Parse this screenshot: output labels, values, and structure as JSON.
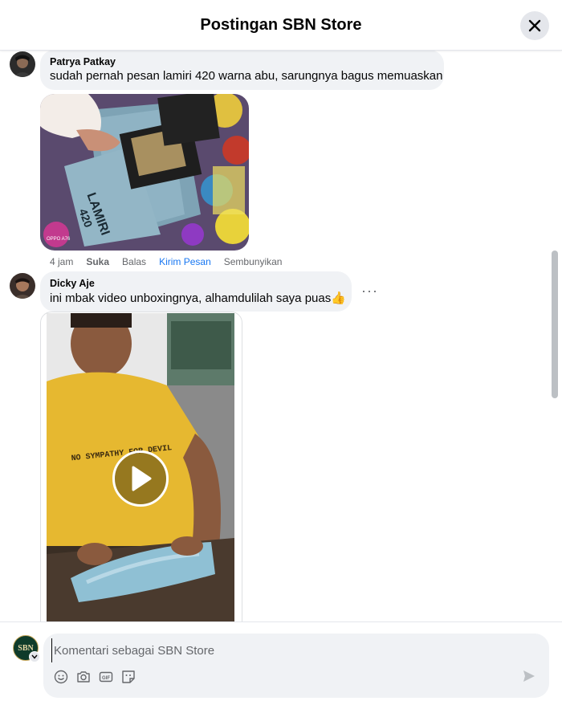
{
  "header": {
    "title": "Postingan SBN Store"
  },
  "comments": [
    {
      "author": "Patrya Patkay",
      "text": "sudah pernah pesan lamiri 420 warna abu, sarungnya bagus memuaskan",
      "media_watermark": "OPPO A76",
      "actions": {
        "time": "4 jam",
        "like": "Suka",
        "reply": "Balas",
        "send_message": "Kirim Pesan",
        "hide": "Sembunyikan"
      }
    },
    {
      "author": "Dicky Aje",
      "text": "ini mbak video unboxingnya, alhamdulilah saya puas👍",
      "more": "···",
      "video_shirt_text": "NO SYMPATHY FOR DEVIL"
    }
  ],
  "composer": {
    "placeholder": "Komentari sebagai SBN Store",
    "page_avatar_text": "SBN"
  },
  "colors": {
    "accent": "#1877f2",
    "bubble": "#f0f2f5",
    "muted": "#65676b"
  },
  "icons": [
    "close-icon",
    "emoji-icon",
    "camera-icon",
    "gif-icon",
    "sticker-icon",
    "send-icon",
    "play-icon",
    "chevron-down-icon"
  ]
}
